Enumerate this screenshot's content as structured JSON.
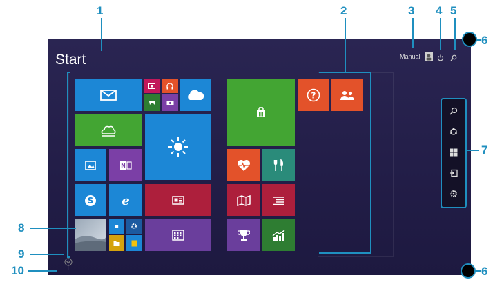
{
  "start_screen": {
    "title": "Start",
    "user_name": "Manual"
  },
  "callouts": [
    "1",
    "2",
    "3",
    "4",
    "5",
    "6",
    "7",
    "8",
    "9",
    "10",
    "6"
  ],
  "colors": {
    "background": "#241f4a",
    "callout": "#1f8fbf",
    "blue": "#1c87d6",
    "green": "#43a533",
    "red": "#d93a48",
    "crimson": "#ad1f3c",
    "purple": "#6a3e9c",
    "orange": "#e3522a"
  },
  "icons": {
    "mail": "mail-icon",
    "weather": "sun-icon",
    "store": "store-icon",
    "help": "question-icon",
    "people": "people-icon",
    "charms": [
      "search-icon",
      "share-icon",
      "windows-icon",
      "devices-icon",
      "settings-icon"
    ]
  }
}
